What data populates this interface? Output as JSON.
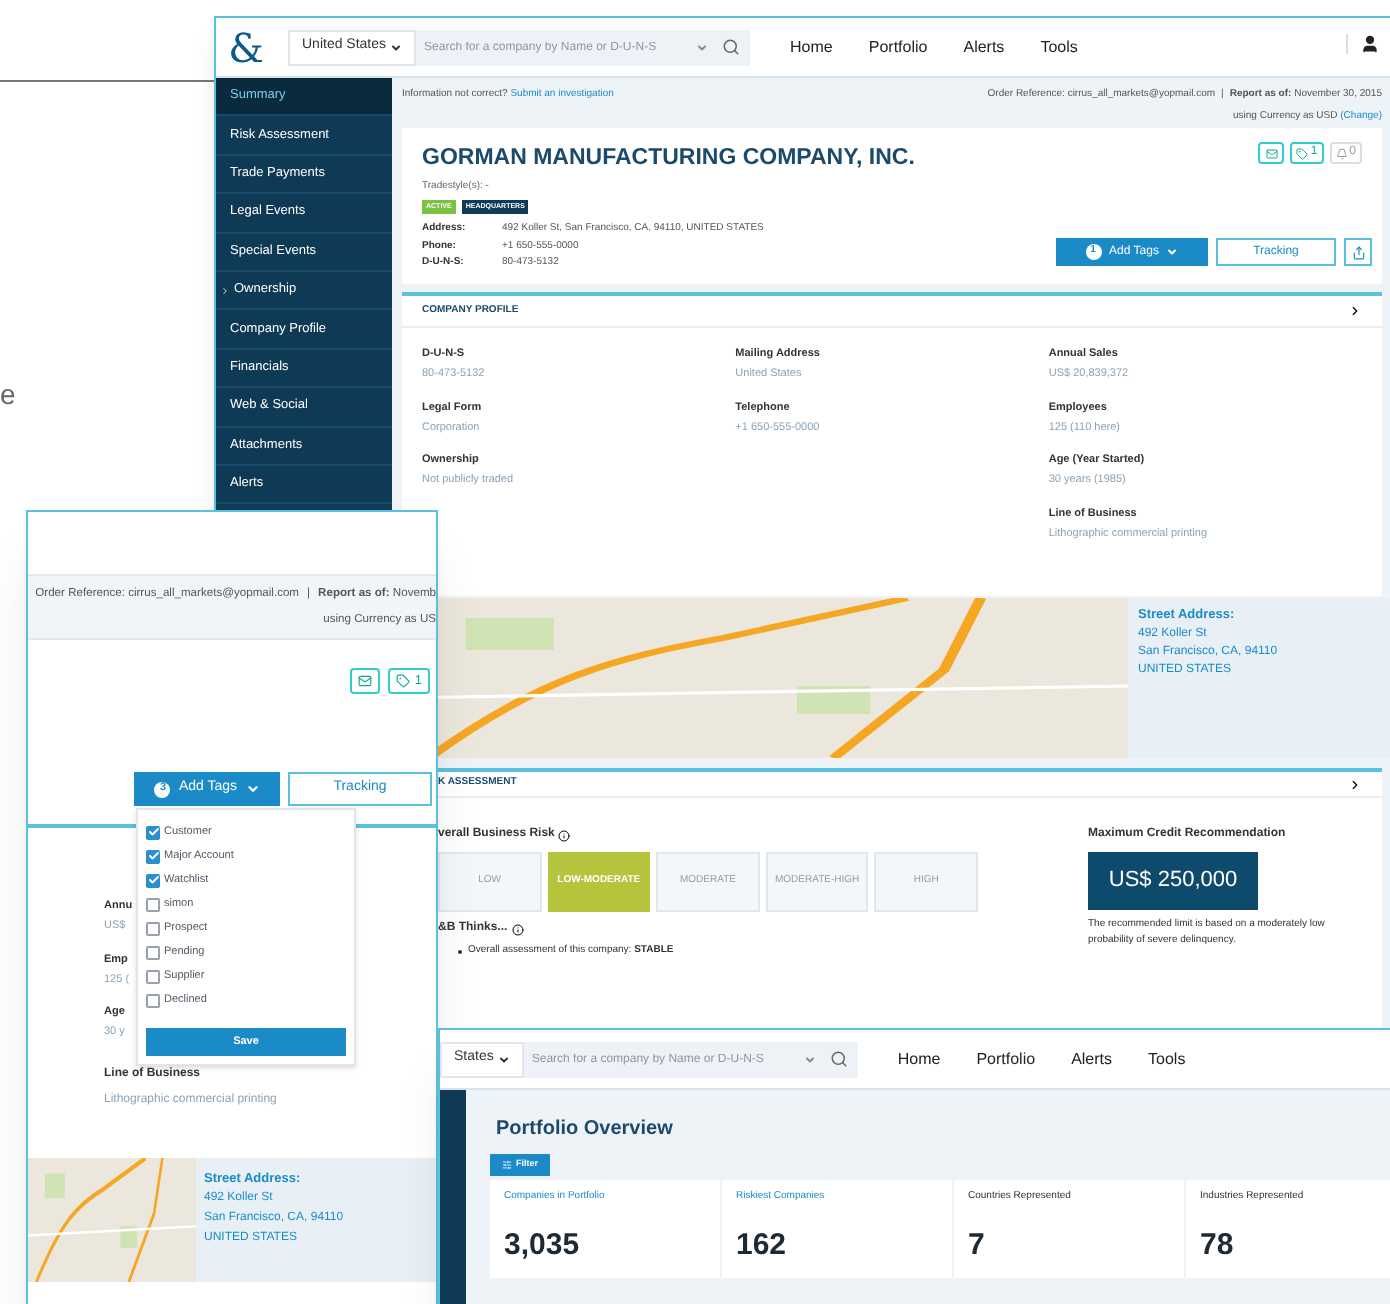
{
  "edge_text": "e",
  "main_window": {
    "nav": {
      "logo": "&",
      "country": "United States",
      "search_placeholder": "Search for a company by Name or D-U-N-S",
      "links": [
        "Home",
        "Portfolio",
        "Alerts",
        "Tools"
      ]
    },
    "sidebar": [
      {
        "label": "Summary",
        "selected": true,
        "expandable": false
      },
      {
        "label": "Risk Assessment",
        "selected": false,
        "expandable": false
      },
      {
        "label": "Trade Payments",
        "selected": false,
        "expandable": false
      },
      {
        "label": "Legal Events",
        "selected": false,
        "expandable": false
      },
      {
        "label": "Special Events",
        "selected": false,
        "expandable": false
      },
      {
        "label": "Ownership",
        "selected": false,
        "expandable": true
      },
      {
        "label": "Company Profile",
        "selected": false,
        "expandable": false
      },
      {
        "label": "Financials",
        "selected": false,
        "expandable": false
      },
      {
        "label": "Web & Social",
        "selected": false,
        "expandable": false
      },
      {
        "label": "Attachments",
        "selected": false,
        "expandable": false
      },
      {
        "label": "Alerts",
        "selected": false,
        "expandable": false
      }
    ],
    "notice": {
      "text": "Information not correct?",
      "link": "Submit an investigation"
    },
    "order_reference": {
      "label": "Order Reference:",
      "value": "cirrus_all_markets@yopmail.com",
      "separator": "|",
      "report_label": "Report as of:",
      "report_date": "November 30, 2015",
      "currency_text": "using Currency as USD",
      "currency_link": "(Change)"
    },
    "company": {
      "name": "GORMAN MANUFACTURING COMPANY, INC.",
      "tradestyle": "Tradestyle(s): -",
      "badges": [
        {
          "label": "ACTIVE",
          "color": "#7cc242"
        },
        {
          "label": "HEADQUARTERS",
          "color": "#0e3b5a"
        }
      ],
      "details": [
        {
          "label": "Address:",
          "value": "492 Koller St, San Francisco, CA, 94110, UNITED STATES"
        },
        {
          "label": "Phone:",
          "value": "+1 650-555-0000"
        },
        {
          "label": "D-U-N-S:",
          "value": "80-473-5132"
        }
      ],
      "tag_count": "1",
      "alert_count": "0",
      "alerts_disabled": true,
      "add_tags": {
        "count": "1",
        "label": "Add Tags"
      },
      "tracking": "Tracking"
    },
    "profile": {
      "title": "COMPANY PROFILE",
      "columns": [
        [
          {
            "label": "D-U-N-S",
            "value": "80-473-5132"
          },
          {
            "label": "Legal Form",
            "value": "Corporation"
          },
          {
            "label": "Ownership",
            "value": "Not publicly traded"
          }
        ],
        [
          {
            "label": "Mailing Address",
            "value": "United States"
          },
          {
            "label": "Telephone",
            "value": "+1 650-555-0000"
          }
        ],
        [
          {
            "label": "Annual Sales",
            "value": "US$ 20,839,372"
          },
          {
            "label": "Employees",
            "value": "125 (110 here)"
          },
          {
            "label": "Age (Year Started)",
            "value": "30 years (1985)"
          },
          {
            "label": "Line of Business",
            "value": "Lithographic commercial printing"
          }
        ]
      ]
    },
    "map_address": {
      "title": "Street Address:",
      "lines": [
        "492 Koller St",
        "San Francisco, CA, 94110",
        "UNITED STATES"
      ]
    },
    "risk": {
      "title": "K ASSESSMENT",
      "overall_label": "verall Business Risk",
      "levels": [
        {
          "label": "LOW",
          "selected": false
        },
        {
          "label": "LOW-MODERATE",
          "selected": true
        },
        {
          "label": "MODERATE",
          "selected": false
        },
        {
          "label": "MODERATE-HIGH",
          "selected": false
        },
        {
          "label": "HIGH",
          "selected": false
        }
      ],
      "thinks_title": "&B Thinks...",
      "bullet": "Overall assessment of this company: **STABLE**",
      "credit_title": "Maximum Credit Recommendation",
      "credit_value": "US$ 250,000",
      "credit_note": "The recommended limit is based on a moderately low probability of severe delinquency."
    }
  },
  "tags_window": {
    "order_reference": {
      "label": "Order Reference:",
      "value": "cirrus_all_markets@yopmail.com",
      "separator": "|",
      "report_label": "Report as of:",
      "report_date": "Novemb",
      "currency_text": "using Currency as US"
    },
    "tag_count": "1",
    "add_tags": {
      "count": "3",
      "label": "Add Tags"
    },
    "tracking": "Tracking",
    "tag_options": [
      {
        "label": "Customer",
        "checked": true
      },
      {
        "label": "Major Account",
        "checked": true
      },
      {
        "label": "Watchlist",
        "checked": true
      },
      {
        "label": "simon",
        "checked": false
      },
      {
        "label": "Prospect",
        "checked": false
      },
      {
        "label": "Pending",
        "checked": false
      },
      {
        "label": "Supplier",
        "checked": false
      },
      {
        "label": "Declined",
        "checked": false
      }
    ],
    "save": "Save",
    "behind_fragments": [
      "Annu",
      "US$",
      "Emp",
      "125 (",
      "Age",
      "30 y"
    ],
    "line_of_business": {
      "label": "Line of Business",
      "value": "Lithographic commercial printing"
    },
    "map_address": {
      "title": "Street Address:",
      "lines": [
        "492 Koller St",
        "San Francisco, CA, 94110",
        "UNITED STATES"
      ]
    }
  },
  "portfolio_window": {
    "nav": {
      "country": "States",
      "search_placeholder": "Search for a company by Name or D-U-N-S",
      "links": [
        "Home",
        "Portfolio",
        "Alerts",
        "Tools"
      ]
    },
    "title": "Portfolio Overview",
    "filter": "Filter",
    "stats": [
      {
        "label": "Companies in Portfolio",
        "value": "3,035",
        "linked": true
      },
      {
        "label": "Riskiest Companies",
        "value": "162",
        "linked": true
      },
      {
        "label": "Countries Represented",
        "value": "7",
        "linked": false
      },
      {
        "label": "Industries Represented",
        "value": "78",
        "linked": false
      }
    ]
  }
}
